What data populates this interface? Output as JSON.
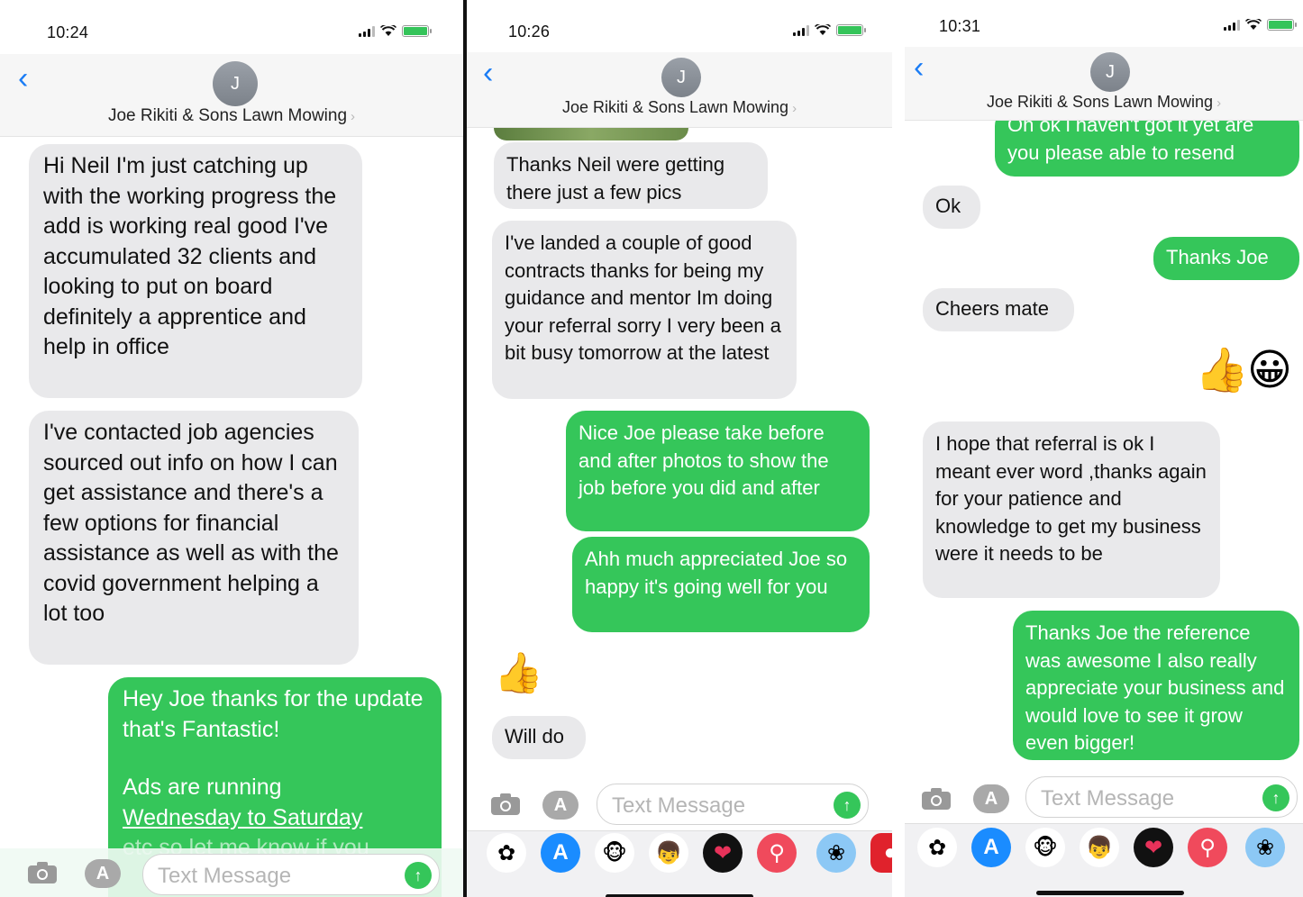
{
  "contact_name": "Joe Rikiti & Sons Lawn Mowing",
  "avatar_initial": "J",
  "compose_placeholder": "Text Message",
  "panels": [
    {
      "time": "10:24",
      "messages": [
        {
          "dir": "in",
          "text": "Hi Neil I'm just catching up with the working progress the add is working real good I've accumulated 32 clients and looking to put on board definitely a apprentice and help in office"
        },
        {
          "dir": "in",
          "text": "I've contacted job agencies sourced out info on how I can get assistance and there's  a few options for financial assistance as well as with the covid government helping a lot too"
        },
        {
          "dir": "out",
          "line1": "Hey Joe thanks for the update that's Fantastic!",
          "line2": "Ads are running",
          "line3": "Wednesday to Saturday",
          "line4": "etc so let me know if you"
        }
      ]
    },
    {
      "time": "10:26",
      "messages": [
        {
          "dir": "in",
          "text": "Thanks Neil were getting there just a few pics"
        },
        {
          "dir": "in",
          "text": "I've landed a couple of good contracts thanks for being my guidance and mentor Im doing  your referral sorry I very been a bit busy tomorrow at the latest"
        },
        {
          "dir": "out",
          "text": "Nice Joe please take before and after photos to show the job before you did and after"
        },
        {
          "dir": "out",
          "text": "Ahh much appreciated Joe so happy it's going well for you"
        },
        {
          "dir": "in",
          "text": "Will do"
        }
      ]
    },
    {
      "time": "10:31",
      "messages": [
        {
          "dir": "out",
          "text": "Oh ok i haven't got it yet are you please able to resend"
        },
        {
          "dir": "in",
          "text": "Ok"
        },
        {
          "dir": "out",
          "text": "Thanks Joe"
        },
        {
          "dir": "in",
          "text": "Cheers mate"
        },
        {
          "dir": "in",
          "text": "I hope that referral is ok I meant ever word ,thanks again for your patience and knowledge to get my business were it needs to be"
        },
        {
          "dir": "out",
          "text": "Thanks Joe the reference was awesome I also really appreciate your business and would love to see it grow even bigger!"
        }
      ]
    }
  ],
  "icons": {
    "back": "chevron-left-icon",
    "camera": "camera-icon",
    "apps": "app-store-icon",
    "send": "send-arrow-icon",
    "tray": [
      "photos-app-icon",
      "app-store-icon",
      "memoji-monkey-icon",
      "memoji-kids-icon",
      "digital-touch-icon",
      "search-images-icon",
      "sticker-app-icon"
    ]
  },
  "colors": {
    "outgoing": "#35c65a",
    "incoming": "#e9e9eb",
    "accent": "#1a7cf5"
  }
}
